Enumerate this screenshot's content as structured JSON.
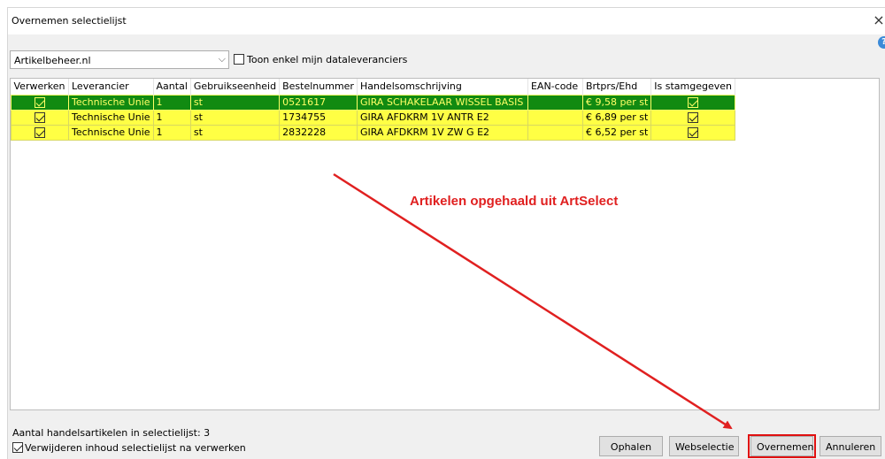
{
  "window": {
    "title": "Overnemen selectielijst",
    "close_glyph": "×",
    "help_glyph": "?"
  },
  "supplier_combo": {
    "value": "Artikelbeheer.nl",
    "arrow_glyph": "⌵"
  },
  "only_my_data_suppliers": {
    "label": "Toon enkel mijn dataleveranciers",
    "checked": false
  },
  "grid": {
    "columns": [
      "Verwerken",
      "Leverancier",
      "Aantal",
      "Gebruikseenheid",
      "Bestelnummer",
      "Handelsomschrijving",
      "EAN-code",
      "Brtprs/Ehd",
      "Is stamgegeven"
    ],
    "rows": [
      {
        "verwerken": true,
        "leverancier": "Technische Unie",
        "aantal": "1",
        "eenheid": "st",
        "bestelnummer": "0521617",
        "omschrijving": "GIRA SCHAKELAAR WISSEL  BASIS",
        "ean": "",
        "prijs": "€ 9,58 per st",
        "stamgegeven": true
      },
      {
        "verwerken": true,
        "leverancier": "Technische Unie",
        "aantal": "1",
        "eenheid": "st",
        "bestelnummer": "1734755",
        "omschrijving": "GIRA AFDKRM 1V ANTR E2",
        "ean": "",
        "prijs": "€ 6,89 per st",
        "stamgegeven": true
      },
      {
        "verwerken": true,
        "leverancier": "Technische Unie",
        "aantal": "1",
        "eenheid": "st",
        "bestelnummer": "2832228",
        "omschrijving": "GIRA AFDKRM 1V ZW G E2",
        "ean": "",
        "prijs": "€ 6,52 per st",
        "stamgegeven": true
      }
    ]
  },
  "annotation": {
    "text": "Artikelen opgehaald uit ArtSelect",
    "color": "#e02020"
  },
  "footer": {
    "count_label": "Aantal handelsartikelen in selectielijst: 3",
    "remove_after_label": "Verwijderen inhoud selectielijst na verwerken",
    "remove_after_checked": true
  },
  "buttons": {
    "ophalen": "Ophalen",
    "webselectie": "Webselectie",
    "overnemen": "Overnemen",
    "annuleren": "Annuleren"
  },
  "colors": {
    "selected_row_bg": "#118a11",
    "selected_row_text": "#ffff66",
    "highlight_row_bg": "#ffff44",
    "highlight_box": "#e01010"
  }
}
